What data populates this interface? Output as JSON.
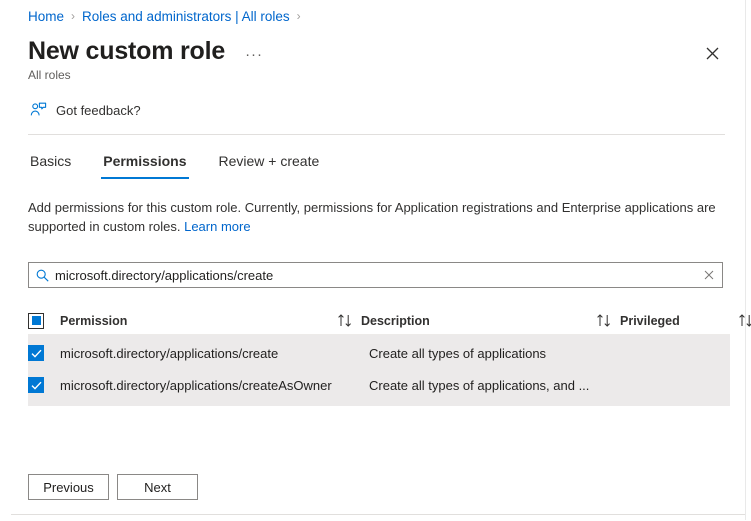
{
  "breadcrumb": {
    "items": [
      {
        "label": "Home"
      },
      {
        "label": "Roles and administrators | All roles"
      }
    ],
    "separator": "›"
  },
  "header": {
    "title": "New custom role",
    "subtitle": "All roles",
    "more_label": "···",
    "close_label": "✕"
  },
  "commandbar": {
    "feedback_label": "Got feedback?",
    "feedback_icon": "feedback-person-icon"
  },
  "tabs": [
    {
      "label": "Basics",
      "active": false
    },
    {
      "label": "Permissions",
      "active": true
    },
    {
      "label": "Review + create",
      "active": false
    }
  ],
  "description": {
    "text": "Add permissions for this custom role. Currently, permissions for Application registrations and Enterprise applications are supported in custom roles.",
    "link_label": "Learn more"
  },
  "search": {
    "value": "microsoft.directory/applications/create",
    "placeholder": "Search permissions",
    "icon": "search-icon",
    "clear_label": "✕"
  },
  "table": {
    "select_all_state": "indeterminate",
    "columns": [
      {
        "key": "permission",
        "label": "Permission",
        "sortable": true
      },
      {
        "key": "description",
        "label": "Description",
        "sortable": true
      },
      {
        "key": "privileged",
        "label": "Privileged",
        "sortable": true
      }
    ],
    "sort_icon": "sort-updown-icon",
    "rows": [
      {
        "checked": true,
        "permission": "microsoft.directory/applications/create",
        "description": "Create all types of applications",
        "privileged": ""
      },
      {
        "checked": true,
        "permission": "microsoft.directory/applications/createAsOwner",
        "description": "Create all types of applications, and ...",
        "privileged": ""
      }
    ]
  },
  "footer": {
    "previous_label": "Previous",
    "next_label": "Next"
  },
  "colors": {
    "accent": "#0078d4",
    "link": "#0066cc",
    "selected_row": "#eceaea",
    "border": "#8a8886"
  }
}
